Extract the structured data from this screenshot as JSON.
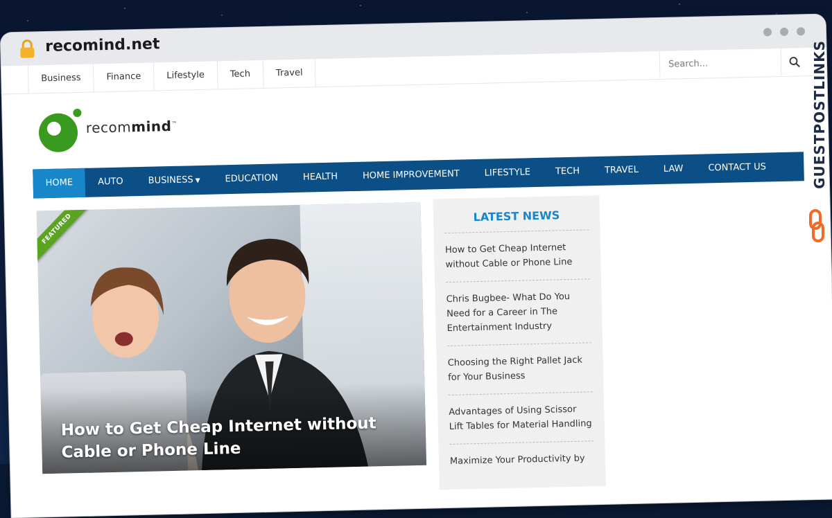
{
  "browser": {
    "url": "recomind.net"
  },
  "top_nav": {
    "items": [
      "Business",
      "Finance",
      "Lifestyle",
      "Tech",
      "Travel"
    ],
    "search_placeholder": "Search..."
  },
  "logo": {
    "prefix": "recom",
    "suffix": "mind",
    "tm": "™"
  },
  "main_nav": {
    "items": [
      "HOME",
      "AUTO",
      "BUSINESS",
      "EDUCATION",
      "HEALTH",
      "HOME IMPROVEMENT",
      "LIFESTYLE",
      "TECH",
      "TRAVEL",
      "LAW",
      "CONTACT US"
    ],
    "active": "HOME"
  },
  "featured": {
    "ribbon": "FEATURED",
    "title": "How to Get Cheap Internet without Cable or Phone Line"
  },
  "latest_news": {
    "heading": "LATEST NEWS",
    "items": [
      "How to Get Cheap Internet without Cable or Phone Line",
      "Chris Bugbee- What Do You Need for a Career in The Entertainment Industry",
      "Choosing the Right Pallet Jack for Your Business",
      "Advantages of Using Scissor Lift Tables for Material Handling",
      "Maximize Your Productivity by"
    ]
  },
  "side_badge": {
    "text": "GUESTPOSTLINKS"
  },
  "colors": {
    "nav_blue": "#0c4f86",
    "nav_active": "#1787c9",
    "logo_green": "#3a9a1f",
    "ribbon_green": "#5aa421",
    "accent_orange": "#f06a2a"
  }
}
